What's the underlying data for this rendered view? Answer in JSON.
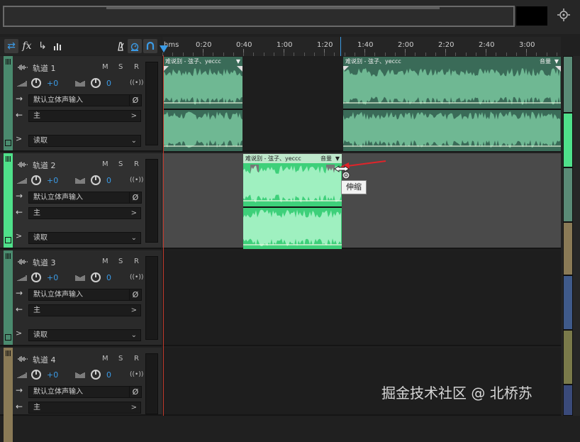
{
  "ruler": {
    "ticks": [
      "hms",
      "0:20",
      "0:40",
      "1:00",
      "1:20",
      "1:40",
      "2:00",
      "2:20",
      "2:40",
      "3:00"
    ]
  },
  "tracks": [
    {
      "name": "轨道 1",
      "mute": "M",
      "solo": "S",
      "record": "R",
      "input": "I",
      "vol": "+0",
      "pan": "0",
      "input_label": "默认立体声输入",
      "output_label": "主",
      "mode_label": "读取",
      "color": "#4a8a6e"
    },
    {
      "name": "轨道 2",
      "mute": "M",
      "solo": "S",
      "record": "R",
      "input": "I",
      "vol": "+0",
      "pan": "0",
      "input_label": "默认立体声输入",
      "output_label": "主",
      "mode_label": "读取",
      "color": "#4fe08a"
    },
    {
      "name": "轨道 3",
      "mute": "M",
      "solo": "S",
      "record": "R",
      "input": "I",
      "vol": "+0",
      "pan": "0",
      "input_label": "默认立体声输入",
      "output_label": "主",
      "mode_label": "读取",
      "color": "#4a8a6e"
    },
    {
      "name": "轨道 4",
      "mute": "M",
      "solo": "S",
      "record": "R",
      "input": "I",
      "vol": "+0",
      "pan": "0",
      "input_label": "默认立体声输入",
      "output_label": "主",
      "color": "#8a7a56"
    }
  ],
  "clips": {
    "clip_a_title": "难说别 - 弦子、yeccc",
    "clip_b_title": "难说别 - 弦子、yeccc",
    "clip_b_vol": "音量",
    "clip_c_title": "难说别 - 弦子、yeccc",
    "clip_c_vol": "音量"
  },
  "tooltip": "伸缩",
  "watermark": "掘金技术社区 @ 北桥苏",
  "icons": {
    "toolbar": [
      "swap-icon",
      "fx-icon",
      "send-icon",
      "bar-chart-icon",
      "metronome-icon",
      "timer-icon",
      "snap-magnet-icon"
    ],
    "zoom": "zoom-target-icon"
  },
  "colors": {
    "accent": "#3b9be6",
    "clip_dark": "#3f7f67",
    "clip_bright": "#4fe08a",
    "playhead": "#c0392b"
  }
}
